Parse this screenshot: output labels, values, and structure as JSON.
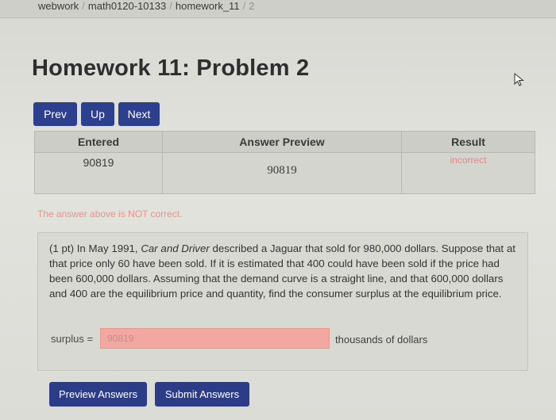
{
  "breadcrumb": [
    "webwork",
    "math0120-10133",
    "homework_11",
    "2"
  ],
  "page_title": "Homework 11: Problem 2",
  "nav": {
    "prev": "Prev",
    "up": "Up",
    "next": "Next"
  },
  "results_table": {
    "headers": [
      "Entered",
      "Answer Preview",
      "Result"
    ],
    "row": {
      "entered": "90819",
      "preview": "90819",
      "result": "incorrect"
    }
  },
  "status_message": "The answer above is NOT correct.",
  "problem": {
    "points": "(1 pt)",
    "text_before": " In May 1991, ",
    "publication": "Car and Driver",
    "text_after": " described a Jaguar that sold for 980,000 dollars. Suppose that at that price only 60 have been sold. If it is estimated that 400 could have been sold if the price had been 600,000 dollars. Assuming that the demand curve is a straight line, and that 600,000 dollars and 400 are the equilibrium price and quantity, find the consumer surplus at the equilibrium price.",
    "answer_label": "surplus =",
    "answer_value": "90819",
    "answer_units": "thousands of dollars"
  },
  "actions": {
    "preview": "Preview Answers",
    "submit": "Submit Answers"
  },
  "colors": {
    "button": "#2d3f8f",
    "incorrect": "#e8938c",
    "input_bg": "#f2a8a1"
  }
}
